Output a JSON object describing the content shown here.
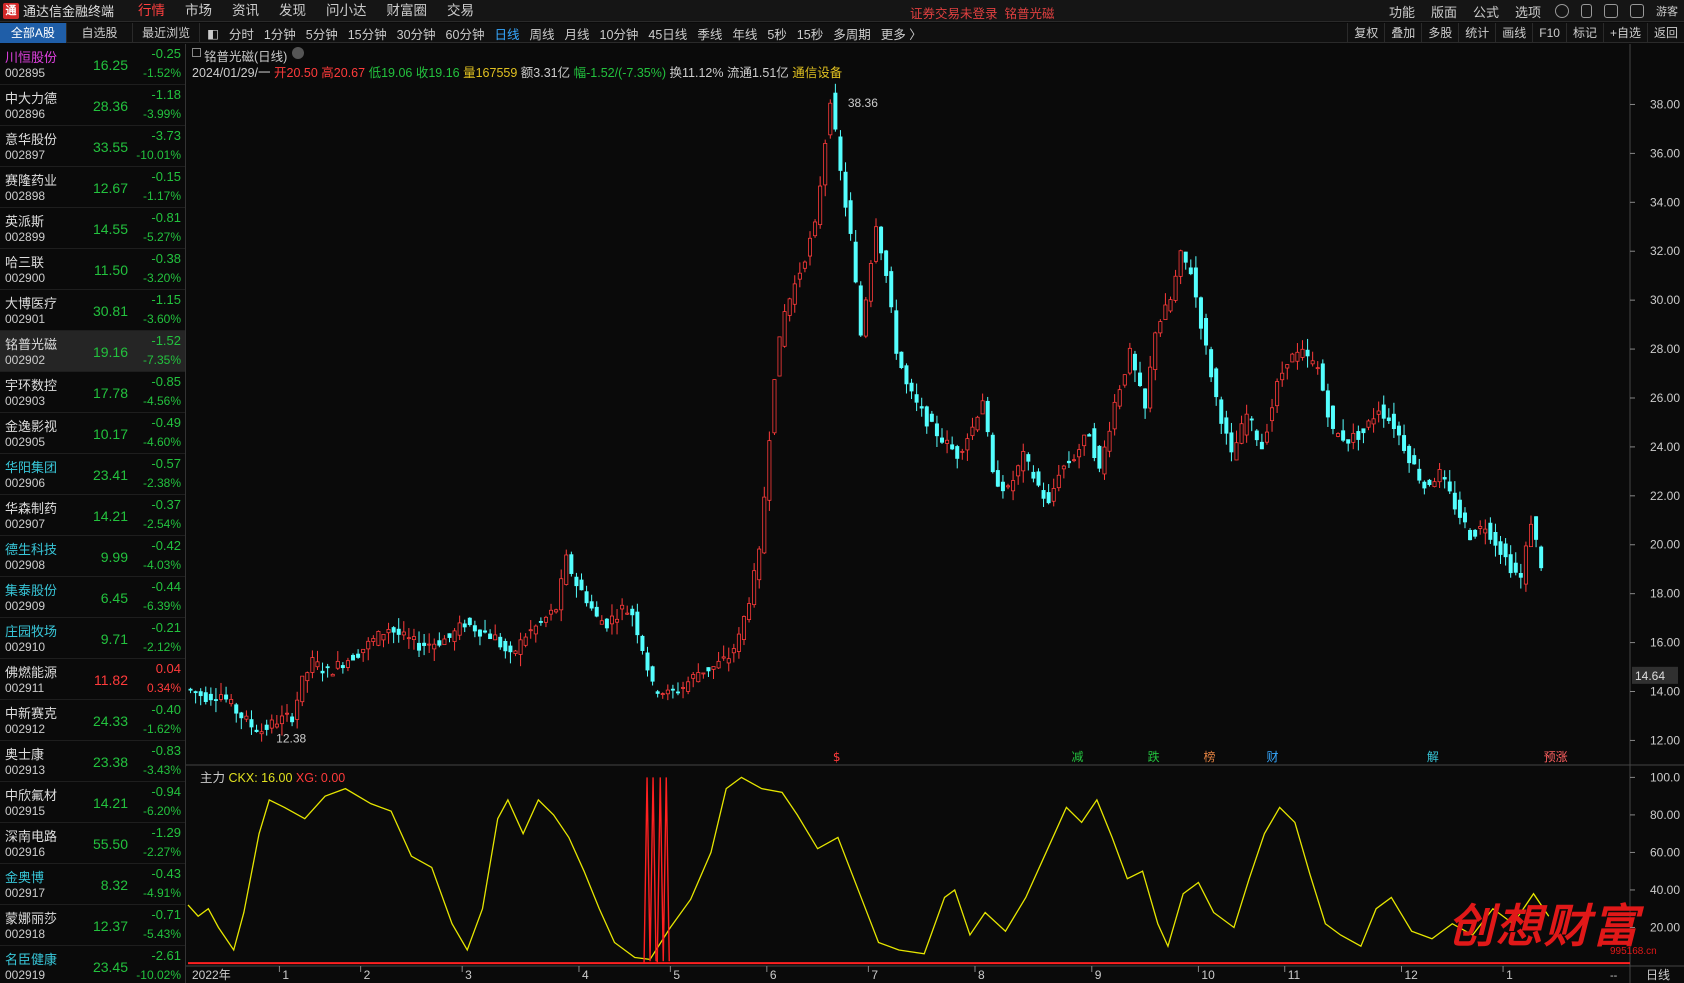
{
  "app": {
    "title": "通达信金融终端",
    "login_notice": "证券交易未登录",
    "notice_stock": "铭普光磁"
  },
  "menu": [
    "行情",
    "市场",
    "资讯",
    "发现",
    "问小达",
    "财富圈",
    "交易"
  ],
  "right_menu": [
    "功能",
    "版面",
    "公式",
    "选项"
  ],
  "guest": "游客",
  "stock_tabs": [
    "全部A股",
    "自选股",
    "最近浏览"
  ],
  "periods": [
    "分时",
    "1分钟",
    "5分钟",
    "15分钟",
    "30分钟",
    "60分钟",
    "日线",
    "周线",
    "月线",
    "10分钟",
    "45日线",
    "季线",
    "年线",
    "5秒",
    "15秒",
    "多周期",
    "更多 〉"
  ],
  "active_period": "日线",
  "right_tools": [
    "复权",
    "叠加",
    "多股",
    "统计",
    "画线",
    "F10",
    "标记",
    "+自选",
    "返回"
  ],
  "stocks": [
    {
      "name": "川恒股份",
      "code": "002895",
      "price": "16.25",
      "chg": "-0.25",
      "pct": "-1.52%",
      "color": "mag"
    },
    {
      "name": "中大力德",
      "code": "002896",
      "price": "28.36",
      "chg": "-1.18",
      "pct": "-3.99%"
    },
    {
      "name": "意华股份",
      "code": "002897",
      "price": "33.55",
      "chg": "-3.73",
      "pct": "-10.01%"
    },
    {
      "name": "赛隆药业",
      "code": "002898",
      "price": "12.67",
      "chg": "-0.15",
      "pct": "-1.17%"
    },
    {
      "name": "英派斯",
      "code": "002899",
      "price": "14.55",
      "chg": "-0.81",
      "pct": "-5.27%"
    },
    {
      "name": "哈三联",
      "code": "002900",
      "price": "11.50",
      "chg": "-0.38",
      "pct": "-3.20%"
    },
    {
      "name": "大博医疗",
      "code": "002901",
      "price": "30.81",
      "chg": "-1.15",
      "pct": "-3.60%"
    },
    {
      "name": "铭普光磁",
      "code": "002902",
      "price": "19.16",
      "chg": "-1.52",
      "pct": "-7.35%",
      "sel": true
    },
    {
      "name": "宇环数控",
      "code": "002903",
      "price": "17.78",
      "chg": "-0.85",
      "pct": "-4.56%"
    },
    {
      "name": "金逸影视",
      "code": "002905",
      "price": "10.17",
      "chg": "-0.49",
      "pct": "-4.60%"
    },
    {
      "name": "华阳集团",
      "code": "002906",
      "price": "23.41",
      "chg": "-0.57",
      "pct": "-2.38%",
      "color": "cyan"
    },
    {
      "name": "华森制药",
      "code": "002907",
      "price": "14.21",
      "chg": "-0.37",
      "pct": "-2.54%"
    },
    {
      "name": "德生科技",
      "code": "002908",
      "price": "9.99",
      "chg": "-0.42",
      "pct": "-4.03%",
      "color": "cyan"
    },
    {
      "name": "集泰股份",
      "code": "002909",
      "price": "6.45",
      "chg": "-0.44",
      "pct": "-6.39%",
      "color": "cyan"
    },
    {
      "name": "庄园牧场",
      "code": "002910",
      "price": "9.71",
      "chg": "-0.21",
      "pct": "-2.12%",
      "color": "cyan"
    },
    {
      "name": "佛燃能源",
      "code": "002911",
      "price": "11.82",
      "chg": "0.04",
      "pct": "0.34%",
      "up": true
    },
    {
      "name": "中新赛克",
      "code": "002912",
      "price": "24.33",
      "chg": "-0.40",
      "pct": "-1.62%"
    },
    {
      "name": "奥士康",
      "code": "002913",
      "price": "23.38",
      "chg": "-0.83",
      "pct": "-3.43%"
    },
    {
      "name": "中欣氟材",
      "code": "002915",
      "price": "14.21",
      "chg": "-0.94",
      "pct": "-6.20%"
    },
    {
      "name": "深南电路",
      "code": "002916",
      "price": "55.50",
      "chg": "-1.29",
      "pct": "-2.27%"
    },
    {
      "name": "金奥博",
      "code": "002917",
      "price": "8.32",
      "chg": "-0.43",
      "pct": "-4.91%",
      "color": "cyan"
    },
    {
      "name": "蒙娜丽莎",
      "code": "002918",
      "price": "12.37",
      "chg": "-0.71",
      "pct": "-5.43%"
    },
    {
      "name": "名臣健康",
      "code": "002919",
      "price": "23.45",
      "chg": "-2.61",
      "pct": "-10.02%",
      "color": "cyan"
    }
  ],
  "chart": {
    "title": "铭普光磁(日线)",
    "info": {
      "date": "2024/01/29/一",
      "open": "开20.50",
      "high": "高20.67",
      "low": "低19.06",
      "close": "收19.16",
      "vol": "量167559",
      "amount": "额3.31亿",
      "amp": "幅-1.52/(-7.35%)",
      "turnover": "换11.12%",
      "float": "流通1.51亿",
      "industry": "通信设备"
    },
    "max_label": "38.36",
    "min_label": "12.38",
    "current_price_label": "14.64",
    "markers": [
      {
        "t": "$",
        "c": "#ff3b3b",
        "m": 6.35
      },
      {
        "t": "减",
        "c": "#23c23e",
        "m": 8.7
      },
      {
        "t": "跌",
        "c": "#23c23e",
        "m": 9.45
      },
      {
        "t": "榜",
        "c": "#e08040",
        "m": 10.0
      },
      {
        "t": "财",
        "c": "#36a8ff",
        "m": 10.62
      },
      {
        "t": "解",
        "c": "#38c6d8",
        "m": 12.2
      },
      {
        "t": "预涨",
        "c": "#ff6060",
        "m": 13.35
      }
    ],
    "indicator": {
      "name": "主力",
      "ckx": "CKX: 16.00",
      "xg": "XG: 0.00",
      "yticks": [
        "100.0",
        "80.00",
        "60.00",
        "40.00",
        "20.00"
      ]
    },
    "bottom_bar": {
      "year": "2022年",
      "right": "日线",
      "dash": "--"
    }
  },
  "chart_data": {
    "type": "line",
    "price_axis": {
      "ticks": [
        38,
        36,
        34,
        32,
        30,
        28,
        26,
        24,
        22,
        20,
        18,
        16,
        14,
        12
      ],
      "ylim": [
        11.2,
        39.0
      ]
    },
    "x_month_ticks": [
      {
        "label": "1",
        "m": 0.9
      },
      {
        "label": "2",
        "m": 1.7
      },
      {
        "label": "3",
        "m": 2.7
      },
      {
        "label": "4",
        "m": 3.85
      },
      {
        "label": "5",
        "m": 4.75
      },
      {
        "label": "6",
        "m": 5.7
      },
      {
        "label": "7",
        "m": 6.7
      },
      {
        "label": "8",
        "m": 7.75
      },
      {
        "label": "9",
        "m": 8.9
      },
      {
        "label": "10",
        "m": 9.95
      },
      {
        "label": "11",
        "m": 10.8
      },
      {
        "label": "12",
        "m": 11.95
      },
      {
        "label": "1",
        "m": 12.95
      }
    ],
    "x_domain": [
      0,
      14.2
    ],
    "price_path": [
      [
        0,
        14.1
      ],
      [
        0.2,
        13.8
      ],
      [
        0.35,
        13.9
      ],
      [
        0.5,
        13.2
      ],
      [
        0.65,
        12.6
      ],
      [
        0.75,
        12.4
      ],
      [
        0.9,
        12.8
      ],
      [
        1.05,
        13.0
      ],
      [
        1.15,
        14.4
      ],
      [
        1.25,
        15.2
      ],
      [
        1.4,
        14.8
      ],
      [
        1.55,
        15.2
      ],
      [
        1.7,
        15.6
      ],
      [
        1.85,
        16.1
      ],
      [
        2.0,
        16.6
      ],
      [
        2.15,
        16.2
      ],
      [
        2.3,
        15.9
      ],
      [
        2.45,
        16.0
      ],
      [
        2.6,
        16.2
      ],
      [
        2.75,
        16.8
      ],
      [
        2.9,
        16.5
      ],
      [
        3.05,
        16.2
      ],
      [
        3.2,
        15.4
      ],
      [
        3.35,
        16.3
      ],
      [
        3.5,
        16.8
      ],
      [
        3.65,
        17.4
      ],
      [
        3.75,
        19.4
      ],
      [
        3.85,
        18.4
      ],
      [
        3.95,
        17.8
      ],
      [
        4.05,
        17.0
      ],
      [
        4.15,
        16.8
      ],
      [
        4.3,
        17.4
      ],
      [
        4.4,
        17.2
      ],
      [
        4.5,
        15.8
      ],
      [
        4.6,
        14.2
      ],
      [
        4.75,
        13.9
      ],
      [
        4.9,
        14.2
      ],
      [
        5.05,
        14.8
      ],
      [
        5.2,
        15.0
      ],
      [
        5.35,
        15.4
      ],
      [
        5.45,
        16.2
      ],
      [
        5.55,
        17.8
      ],
      [
        5.65,
        19.6
      ],
      [
        5.7,
        22.0
      ],
      [
        5.8,
        27.0
      ],
      [
        5.9,
        29.5
      ],
      [
        6.05,
        31.2
      ],
      [
        6.2,
        33.0
      ],
      [
        6.35,
        38.3
      ],
      [
        6.45,
        35.2
      ],
      [
        6.55,
        32.6
      ],
      [
        6.65,
        28.6
      ],
      [
        6.8,
        33.2
      ],
      [
        6.9,
        31.0
      ],
      [
        7.0,
        28.0
      ],
      [
        7.1,
        26.5
      ],
      [
        7.2,
        25.7
      ],
      [
        7.35,
        24.8
      ],
      [
        7.5,
        24.1
      ],
      [
        7.6,
        23.7
      ],
      [
        7.75,
        24.8
      ],
      [
        7.85,
        26.0
      ],
      [
        7.95,
        22.8
      ],
      [
        8.1,
        22.2
      ],
      [
        8.25,
        23.6
      ],
      [
        8.4,
        22.4
      ],
      [
        8.5,
        21.6
      ],
      [
        8.6,
        23.0
      ],
      [
        8.75,
        23.6
      ],
      [
        8.9,
        24.6
      ],
      [
        9.0,
        23.0
      ],
      [
        9.15,
        25.8
      ],
      [
        9.3,
        27.8
      ],
      [
        9.45,
        25.5
      ],
      [
        9.55,
        28.8
      ],
      [
        9.7,
        30.0
      ],
      [
        9.8,
        31.8
      ],
      [
        9.9,
        31.2
      ],
      [
        10.05,
        28.0
      ],
      [
        10.15,
        26.0
      ],
      [
        10.3,
        23.6
      ],
      [
        10.45,
        25.3
      ],
      [
        10.6,
        24.0
      ],
      [
        10.75,
        26.5
      ],
      [
        10.85,
        27.6
      ],
      [
        11.0,
        27.8
      ],
      [
        11.15,
        27.2
      ],
      [
        11.3,
        24.6
      ],
      [
        11.45,
        24.3
      ],
      [
        11.6,
        24.6
      ],
      [
        11.75,
        25.6
      ],
      [
        11.9,
        24.9
      ],
      [
        12.05,
        23.6
      ],
      [
        12.2,
        22.4
      ],
      [
        12.35,
        22.9
      ],
      [
        12.5,
        21.6
      ],
      [
        12.65,
        20.4
      ],
      [
        12.8,
        20.8
      ],
      [
        12.95,
        19.8
      ],
      [
        13.05,
        19.1
      ],
      [
        13.15,
        18.6
      ],
      [
        13.25,
        21.0
      ],
      [
        13.35,
        19.2
      ]
    ],
    "indicator_path": [
      [
        0,
        32
      ],
      [
        0.1,
        26
      ],
      [
        0.2,
        30
      ],
      [
        0.3,
        20
      ],
      [
        0.45,
        8
      ],
      [
        0.55,
        28
      ],
      [
        0.7,
        70
      ],
      [
        0.8,
        88
      ],
      [
        0.95,
        84
      ],
      [
        1.15,
        78
      ],
      [
        1.35,
        90
      ],
      [
        1.55,
        94
      ],
      [
        1.8,
        86
      ],
      [
        2.0,
        82
      ],
      [
        2.2,
        58
      ],
      [
        2.4,
        52
      ],
      [
        2.6,
        22
      ],
      [
        2.75,
        8
      ],
      [
        2.9,
        30
      ],
      [
        3.05,
        78
      ],
      [
        3.15,
        88
      ],
      [
        3.3,
        70
      ],
      [
        3.45,
        88
      ],
      [
        3.6,
        80
      ],
      [
        3.75,
        68
      ],
      [
        3.9,
        50
      ],
      [
        4.05,
        30
      ],
      [
        4.2,
        12
      ],
      [
        4.4,
        4
      ],
      [
        4.55,
        3
      ],
      [
        4.75,
        20
      ],
      [
        4.95,
        35
      ],
      [
        5.15,
        60
      ],
      [
        5.3,
        94
      ],
      [
        5.45,
        100
      ],
      [
        5.65,
        94
      ],
      [
        5.85,
        92
      ],
      [
        6.0,
        80
      ],
      [
        6.2,
        62
      ],
      [
        6.4,
        68
      ],
      [
        6.6,
        40
      ],
      [
        6.8,
        12
      ],
      [
        7.0,
        8
      ],
      [
        7.25,
        6
      ],
      [
        7.45,
        36
      ],
      [
        7.55,
        40
      ],
      [
        7.7,
        16
      ],
      [
        7.85,
        28
      ],
      [
        8.05,
        18
      ],
      [
        8.25,
        36
      ],
      [
        8.45,
        60
      ],
      [
        8.65,
        84
      ],
      [
        8.8,
        76
      ],
      [
        8.95,
        88
      ],
      [
        9.1,
        68
      ],
      [
        9.25,
        46
      ],
      [
        9.4,
        50
      ],
      [
        9.55,
        22
      ],
      [
        9.65,
        10
      ],
      [
        9.8,
        38
      ],
      [
        9.95,
        44
      ],
      [
        10.1,
        28
      ],
      [
        10.3,
        20
      ],
      [
        10.45,
        46
      ],
      [
        10.6,
        70
      ],
      [
        10.75,
        84
      ],
      [
        10.9,
        76
      ],
      [
        11.05,
        48
      ],
      [
        11.2,
        22
      ],
      [
        11.35,
        16
      ],
      [
        11.55,
        10
      ],
      [
        11.7,
        30
      ],
      [
        11.85,
        36
      ],
      [
        12.05,
        18
      ],
      [
        12.25,
        14
      ],
      [
        12.45,
        22
      ],
      [
        12.65,
        16
      ],
      [
        12.85,
        30
      ],
      [
        13.05,
        22
      ],
      [
        13.25,
        38
      ],
      [
        13.4,
        26
      ]
    ],
    "spike_x": [
      4.55,
      4.68
    ],
    "ind_ylim": [
      0,
      105
    ]
  }
}
